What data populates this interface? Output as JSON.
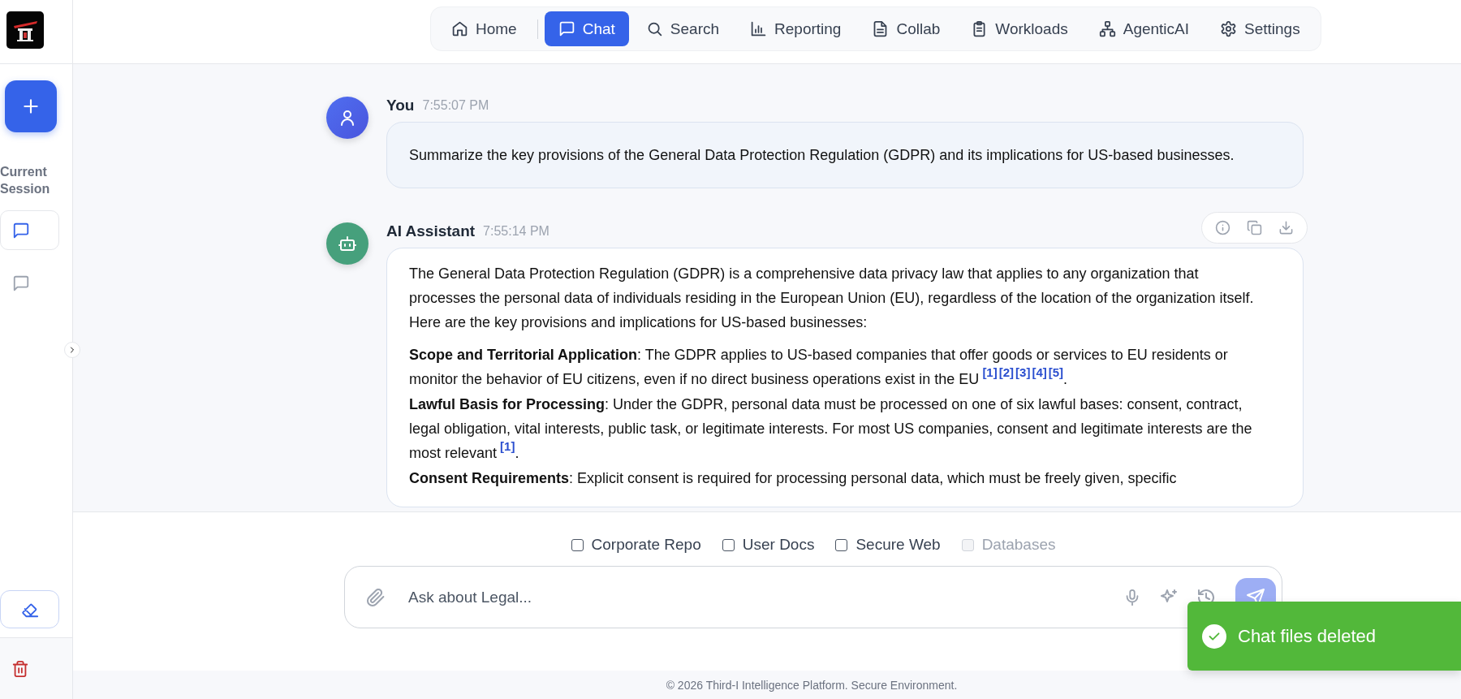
{
  "sidebar": {
    "section_title": "Current Session",
    "sessions": [
      {
        "selected": true
      },
      {
        "selected": false
      }
    ]
  },
  "nav": {
    "items": [
      {
        "label": "Home",
        "selected": false
      },
      {
        "label": "Chat",
        "selected": true
      },
      {
        "label": "Search",
        "selected": false
      },
      {
        "label": "Reporting",
        "selected": false
      },
      {
        "label": "Collab",
        "selected": false
      },
      {
        "label": "Workloads",
        "selected": false
      },
      {
        "label": "AgenticAI",
        "selected": false
      },
      {
        "label": "Settings",
        "selected": false
      }
    ]
  },
  "messages": [
    {
      "kind": "user",
      "author": "You",
      "time": "7:55:07 PM",
      "paragraphs": [
        {
          "text": "Summarize the key provisions of the General Data Protection Regulation (GDPR) and its implications for US-based businesses."
        }
      ]
    },
    {
      "kind": "assistant",
      "author": "AI Assistant",
      "time": "7:55:14 PM",
      "paragraphs": [
        {
          "text": "The General Data Protection Regulation (GDPR) is a comprehensive data privacy law that applies to any organization that processes the personal data of individuals residing in the European Union (EU), regardless of the location of the organization itself. Here are the key provisions and implications for US-based businesses:"
        },
        {
          "text": "**Scope and Territorial Application**: The GDPR applies to US-based companies that offer goods or services to EU residents or monitor the behavior of EU citizens, even if no direct business operations exist in the EU",
          "citations": [
            "[1]",
            "[2]",
            "[3]",
            "[4]",
            "[5]"
          ],
          "after": "."
        },
        {
          "text": "**Lawful Basis for Processing**: Under the GDPR, personal data must be processed on one of six lawful bases: consent, contract, legal obligation, vital interests, public task, or legitimate interests. For most US companies, consent and legitimate interests are the most relevant",
          "citations": [
            "[1]"
          ],
          "after": "."
        },
        {
          "text": "**Consent Requirements**: Explicit consent is required for processing personal data, which must be freely given, specific"
        }
      ]
    }
  ],
  "sources": [
    {
      "label": "Corporate Repo",
      "checked": false,
      "disabled": false
    },
    {
      "label": "User Docs",
      "checked": false,
      "disabled": false
    },
    {
      "label": "Secure Web",
      "checked": false,
      "disabled": false
    },
    {
      "label": "Databases",
      "checked": false,
      "disabled": true
    }
  ],
  "input": {
    "placeholder": "Ask about Legal...",
    "send_disabled": true
  },
  "toast": {
    "kind": "success",
    "message": "Chat files deleted"
  },
  "footer": {
    "text": "© 2026 Third-I Intelligence Platform. Secure Environment."
  }
}
